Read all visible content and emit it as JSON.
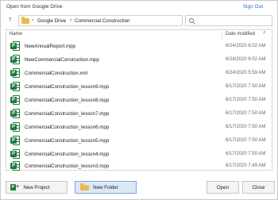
{
  "window": {
    "title": "Open from Google Drive",
    "sign_out": "Sign Out"
  },
  "navigation": {
    "up_icon": "arrow-up-icon",
    "breadcrumb": [
      "Google Drive",
      "Commercial Construction"
    ],
    "separator": "›",
    "refresh_icon": "refresh-icon",
    "search": {
      "placeholder": "",
      "value": ""
    }
  },
  "file_list": {
    "columns": {
      "name": "Name",
      "date": "Date modified",
      "sort_indicator": "˄"
    },
    "files": [
      {
        "name": "NewAnnualReport.mpp",
        "date": "6/24/2020 6:02 AM"
      },
      {
        "name": "NewCommercialConstruction.mpp",
        "date": "6/24/2020 6:02 AM"
      },
      {
        "name": "CommercialConstruction.xml",
        "date": "6/24/2020 5:59 AM"
      },
      {
        "name": "CommercialConstruction_lesson9.mpp",
        "date": "6/17/2020 7:50 AM"
      },
      {
        "name": "CommercialConstruction_lesson8.mpp",
        "date": "6/17/2020 7:50 AM"
      },
      {
        "name": "CommercialConstruction_lesson7.mpp",
        "date": "6/17/2020 7:50 AM"
      },
      {
        "name": "CommercialConstruction_lesson6.mpp",
        "date": "6/17/2020 7:50 AM"
      },
      {
        "name": "CommercialConstruction_lesson5.mpp",
        "date": "6/17/2020 7:50 AM"
      },
      {
        "name": "CommercialConstruction_lesson4.mpp",
        "date": "6/17/2020 7:50 AM"
      },
      {
        "name": "CommercialConstruction_lesson3.mpp",
        "date": "6/17/2020 7:49 AM"
      }
    ]
  },
  "footer": {
    "new_project": "New Project",
    "new_folder": "New Folder",
    "open": "Open",
    "close": "Close"
  },
  "colors": {
    "accent": "#2e6fd0",
    "project_green": "#1f7a3c",
    "folder": "#e7be4c",
    "selected_button": "#dce8f7"
  }
}
